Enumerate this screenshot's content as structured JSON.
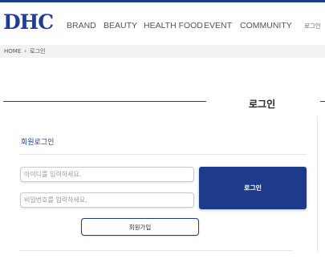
{
  "header": {
    "logo": "DHC",
    "nav": [
      "BRAND",
      "BEAUTY",
      "HEALTH FOOD",
      "EVENT",
      "COMMUNITY"
    ],
    "login_link": "로그인"
  },
  "breadcrumb": {
    "home": "HOME",
    "separator": "›",
    "current": "로그인"
  },
  "page_title": "로그인",
  "login_form": {
    "section_label": "회원로그인",
    "id_placeholder": "아이디를 입력하세요.",
    "password_placeholder": "비밀번호를 입력하세요.",
    "login_button": "로그인",
    "join_button": "회원가입"
  },
  "colors": {
    "brand": "#1e3a8a",
    "breadcrumb_bg": "#f2f2f2"
  }
}
